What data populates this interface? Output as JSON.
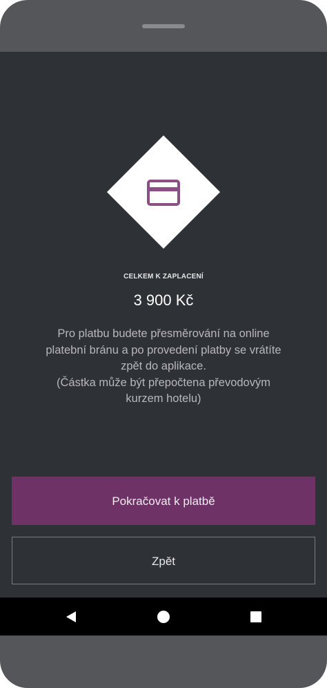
{
  "payment": {
    "total_label": "CELKEM K ZAPLACENÍ",
    "amount": "3 900 Kč",
    "info_text": "Pro platbu budete přesměrování na online\nplatební bránu a po provedení platby se vrátíte\nzpět do aplikace.\n(Částka může být přepočtena převodovým\nkurzem hotelu)",
    "icon": "credit-card-icon"
  },
  "buttons": {
    "continue_label": "Pokračovat k platbě",
    "back_label": "Zpět"
  },
  "navigation": {
    "back_icon": "back-triangle-icon",
    "home_icon": "home-circle-icon",
    "recent_icon": "recent-apps-square-icon"
  },
  "colors": {
    "screen_background": "#2e3135",
    "primary_button": "#6e3266",
    "icon_accent": "#8a4f84",
    "device_frame": "#555659"
  }
}
